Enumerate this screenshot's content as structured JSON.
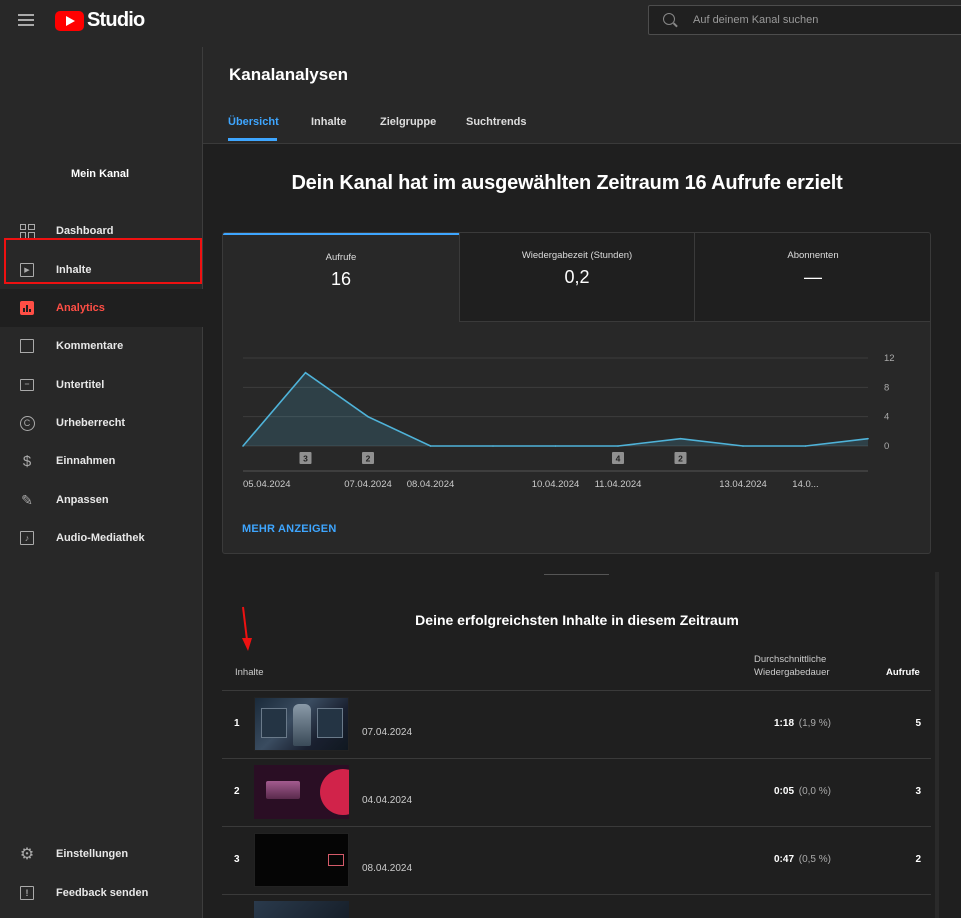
{
  "header": {
    "logo_text": "Studio",
    "search_placeholder": "Auf deinem Kanal suchen"
  },
  "sidebar": {
    "channel_label": "Mein Kanal",
    "items": [
      {
        "label": "Dashboard",
        "icon": "dashboard-icon"
      },
      {
        "label": "Inhalte",
        "icon": "content-icon"
      },
      {
        "label": "Analytics",
        "icon": "analytics-icon",
        "active": true
      },
      {
        "label": "Kommentare",
        "icon": "comments-icon"
      },
      {
        "label": "Untertitel",
        "icon": "subtitles-icon"
      },
      {
        "label": "Urheberrecht",
        "icon": "copyright-icon"
      },
      {
        "label": "Einnahmen",
        "icon": "dollar-icon"
      },
      {
        "label": "Anpassen",
        "icon": "magic-wand-icon"
      },
      {
        "label": "Audio-Mediathek",
        "icon": "audio-library-icon"
      }
    ],
    "bottom_items": [
      {
        "label": "Einstellungen",
        "icon": "gear-icon"
      },
      {
        "label": "Feedback senden",
        "icon": "feedback-icon"
      }
    ]
  },
  "main": {
    "title": "Kanalanalysen",
    "tabs": [
      {
        "label": "Übersicht",
        "active": true
      },
      {
        "label": "Inhalte"
      },
      {
        "label": "Zielgruppe"
      },
      {
        "label": "Suchtrends"
      }
    ],
    "headline": "Dein Kanal hat im ausgewählten Zeitraum 16 Aufrufe erzielt",
    "metrics": [
      {
        "label": "Aufrufe",
        "value": "16",
        "active": true
      },
      {
        "label": "Wiedergabezeit (Stunden)",
        "value": "0,2"
      },
      {
        "label": "Abonnenten",
        "value": "—"
      }
    ],
    "more_link": "MEHR ANZEIGEN",
    "top_content": {
      "title": "Deine erfolgreichsten Inhalte in diesem Zeitraum",
      "col_content": "Inhalte",
      "col_duration_line1": "Durchschnittliche",
      "col_duration_line2": "Wiedergabedauer",
      "col_views": "Aufrufe",
      "rows": [
        {
          "rank": "1",
          "date": "07.04.2024",
          "duration": "1:18",
          "pct": "(1,9 %)",
          "views": "5"
        },
        {
          "rank": "2",
          "date": "04.04.2024",
          "duration": "0:05",
          "pct": "(0,0 %)",
          "views": "3"
        },
        {
          "rank": "3",
          "date": "08.04.2024",
          "duration": "0:47",
          "pct": "(0,5 %)",
          "views": "2"
        }
      ]
    }
  },
  "chart_data": {
    "type": "area",
    "series": [
      {
        "values": [
          0,
          10,
          4,
          0,
          0,
          0,
          0,
          1,
          0,
          0,
          1
        ]
      }
    ],
    "x_tick_labels": [
      {
        "index": 0,
        "label": "05.04.2024"
      },
      {
        "index": 2,
        "label": "07.04.2024"
      },
      {
        "index": 3,
        "label": "08.04.2024"
      },
      {
        "index": 5,
        "label": "10.04.2024"
      },
      {
        "index": 6,
        "label": "11.04.2024"
      },
      {
        "index": 8,
        "label": "13.04.2024"
      },
      {
        "index": 9,
        "label": "14.0..."
      }
    ],
    "y_ticks": [
      0,
      4,
      8,
      12
    ],
    "ylim": [
      0,
      12
    ],
    "markers": [
      {
        "index": 1,
        "label": "3"
      },
      {
        "index": 2,
        "label": "2"
      },
      {
        "index": 6,
        "label": "4"
      },
      {
        "index": 7,
        "label": "2"
      }
    ],
    "line_color": "#4fb3d9",
    "grid": true
  }
}
